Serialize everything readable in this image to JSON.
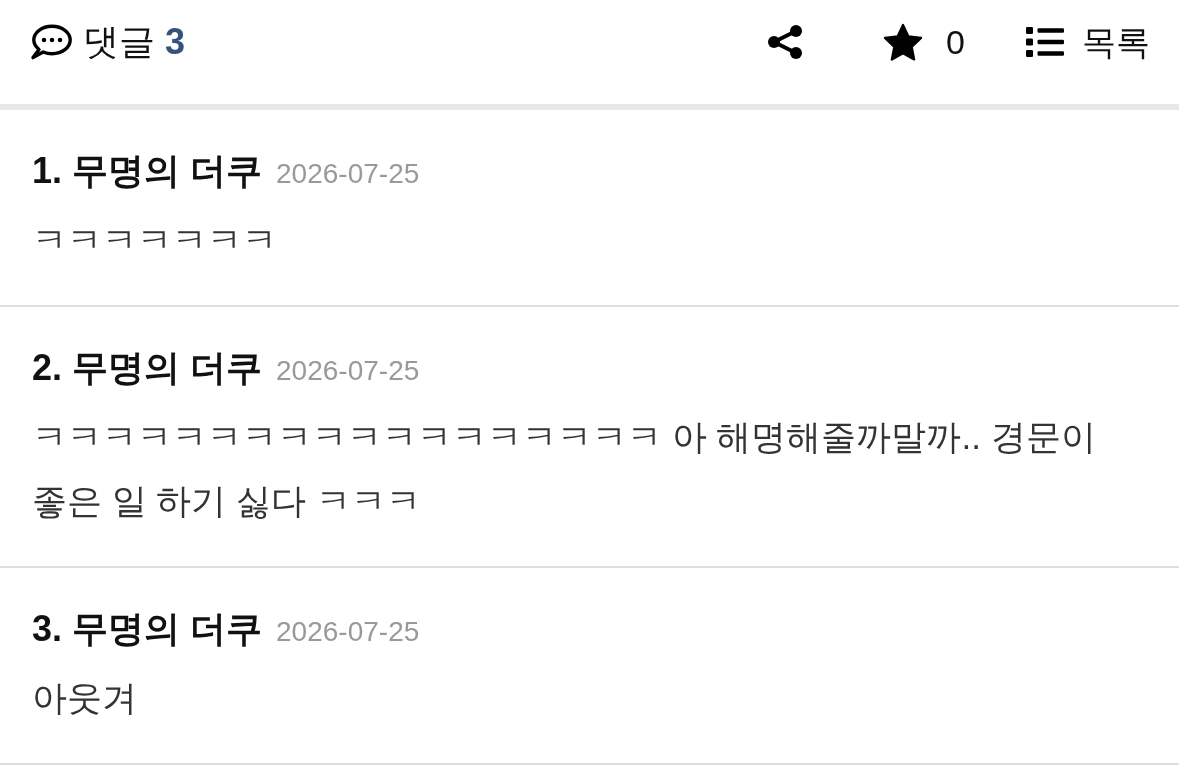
{
  "comment_header": {
    "label": "댓글",
    "count": "3"
  },
  "toolbar": {
    "star_count": "0",
    "list_label": "목록"
  },
  "comments": [
    {
      "number": "1.",
      "author": "무명의 더쿠",
      "date": "2026-07-25",
      "text": "ㅋㅋㅋㅋㅋㅋㅋ"
    },
    {
      "number": "2.",
      "author": "무명의 더쿠",
      "date": "2026-07-25",
      "text": "ㅋㅋㅋㅋㅋㅋㅋㅋㅋㅋㅋㅋㅋㅋㅋㅋㅋㅋ 아 해명해줄까말까.. 경문이 좋은 일 하기 싫다 ㅋㅋㅋ"
    },
    {
      "number": "3.",
      "author": "무명의 더쿠",
      "date": "2026-07-25",
      "text": "아웃겨"
    }
  ]
}
